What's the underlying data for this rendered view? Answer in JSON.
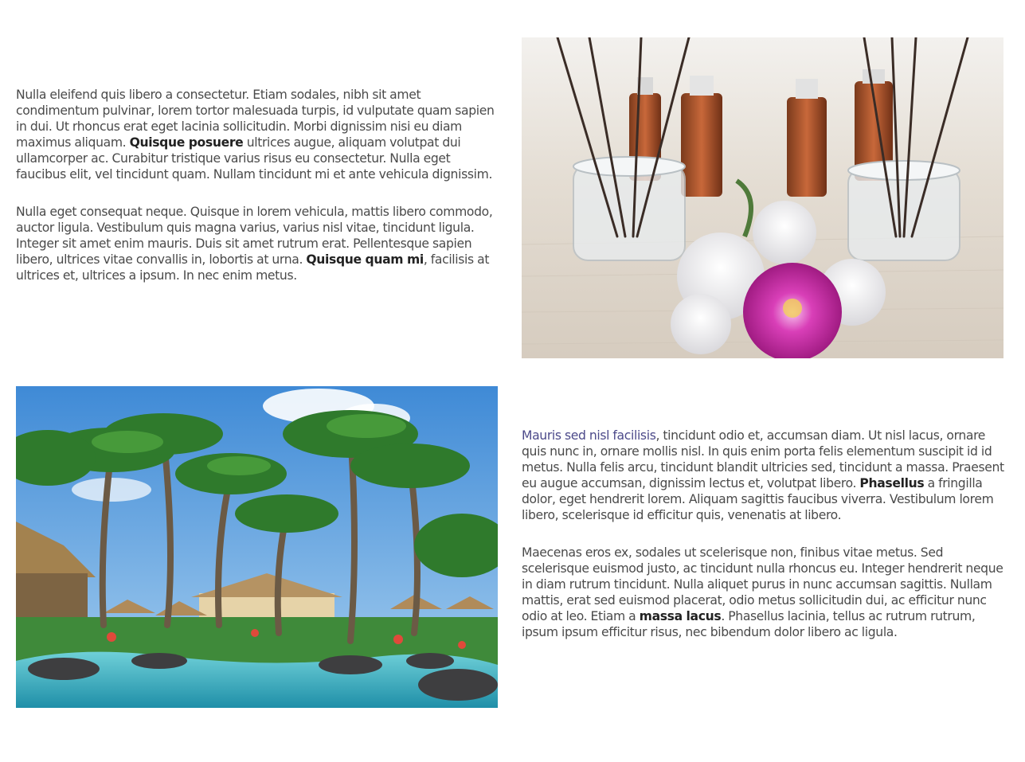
{
  "section_1": {
    "paragraph_1": {
      "part_a": "Nulla eleifend quis libero a consectetur. Etiam sodales, nibh sit amet condimentum pulvinar, lorem tortor malesuada turpis, id vulputate quam sapien in dui. Ut rhoncus erat eget lacinia sollicitudin. Morbi dignissim nisi eu diam maximus aliquam. ",
      "bold": "Quisque posuere",
      "part_b": " ultrices augue, aliquam volutpat dui ullamcorper ac. Curabitur tristique varius risus eu consectetur. Nulla eget faucibus elit, vel tincidunt quam. Nullam tincidunt mi et ante vehicula dignissim."
    },
    "paragraph_2": {
      "part_a": "Nulla eget consequat neque. Quisque in lorem vehicula, mattis libero commodo, auctor ligula. Vestibulum quis magna varius, varius nisl vitae, tincidunt ligula. Integer sit amet enim mauris. Duis sit amet rutrum erat. Pellentesque sapien libero, ultrices vitae convallis in, lobortis at urna. ",
      "bold": "Quisque quam mi",
      "part_b": ", facilisis at ultrices et, ultrices a ipsum. In nec enim metus."
    },
    "image_icon": "spa-aroma-diffuser-image"
  },
  "section_2": {
    "image_icon": "tropical-resort-pool-image",
    "paragraph_1": {
      "link": "Mauris sed nisl facilisis",
      "part_a": ", tincidunt odio et, accumsan diam. Ut nisl lacus, ornare quis nunc in, ornare mollis nisl. In quis enim porta felis elementum suscipit id id metus. Nulla felis arcu, tincidunt blandit ultricies sed, tincidunt a massa. Praesent eu augue accumsan, dignissim lectus et, volutpat libero. ",
      "bold": "Phasellus",
      "part_b": " a fringilla dolor, eget hendrerit lorem. Aliquam sagittis faucibus viverra. Vestibulum lorem libero, scelerisque id efficitur quis, venenatis at libero."
    },
    "paragraph_2": {
      "part_a": "Maecenas eros ex, sodales ut scelerisque non, finibus vitae metus. Sed scelerisque euismod justo, ac tincidunt nulla rhoncus eu. Integer hendrerit neque in diam rutrum tincidunt. Nulla aliquet purus in nunc accumsan sagittis. Nullam mattis, erat sed euismod placerat, odio metus sollicitudin dui, ac efficitur nunc odio at leo. Etiam a ",
      "bold": "massa lacus",
      "part_b": ". Phasellus lacinia, tellus ac rutrum rutrum, ipsum ipsum efficitur risus, nec bibendum dolor libero ac ligula."
    }
  },
  "colors": {
    "text": "#4a4a4a",
    "bold_text": "#222222",
    "link": "#4c4a8a",
    "background": "#ffffff"
  }
}
